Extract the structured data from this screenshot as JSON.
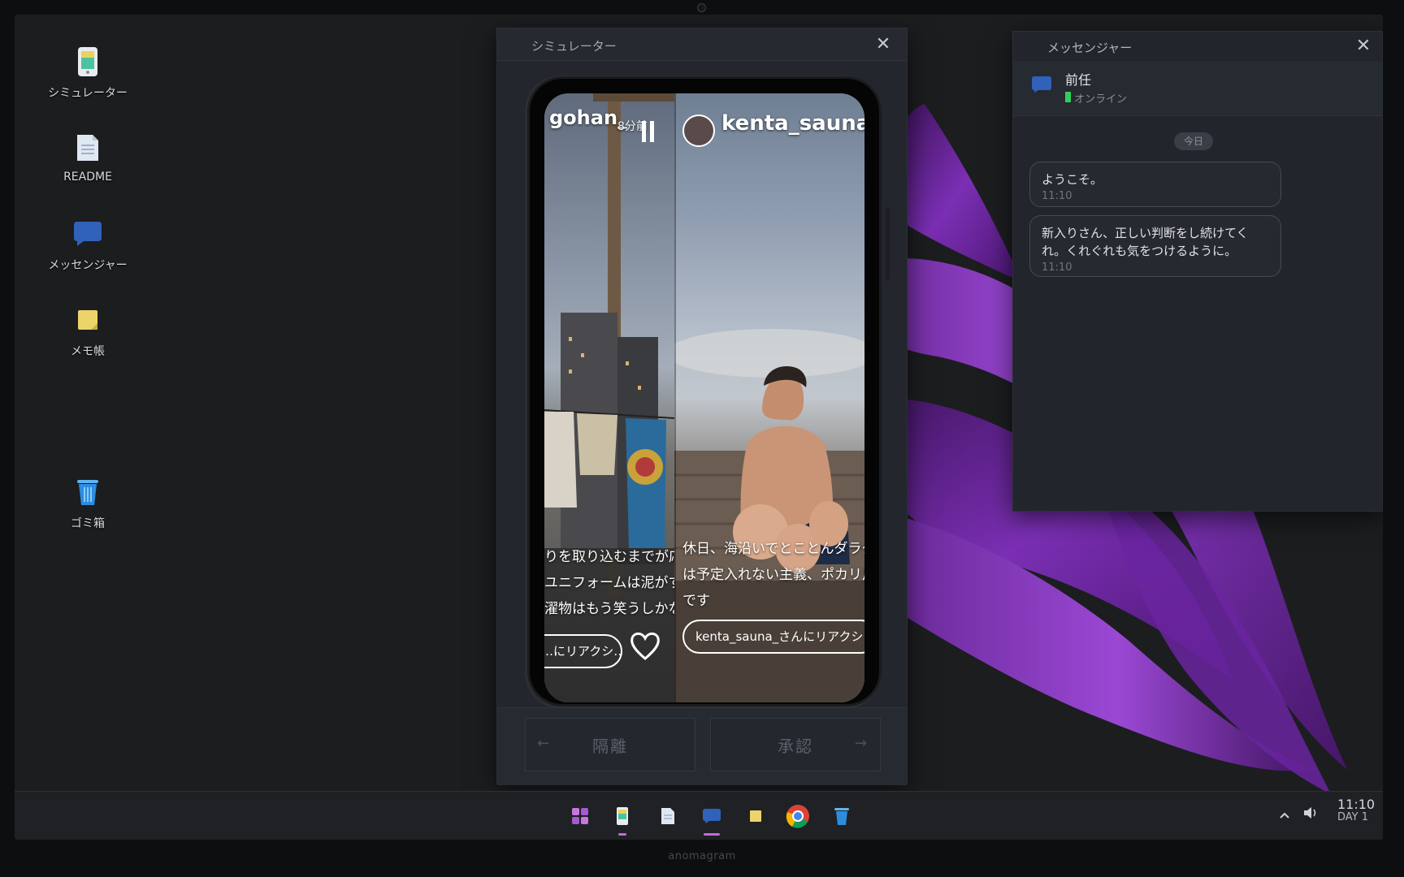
{
  "desktop": {
    "icons": [
      {
        "label": "シミュレーター",
        "icon": "simulator-icon"
      },
      {
        "label": "README",
        "icon": "document-icon"
      },
      {
        "label": "メッセンジャー",
        "icon": "chat-bubble-icon"
      },
      {
        "label": "メモ帳",
        "icon": "sticky-note-icon"
      },
      {
        "label": "ゴミ箱",
        "icon": "trash-icon"
      }
    ]
  },
  "simulator": {
    "title": "シミュレーター",
    "story_left": {
      "username": "gohan_",
      "time": "8分前",
      "caption_lines": [
        "りを取り込むまでが応援で",
        "ユニフォームは泥がすごくて",
        "濯物はもう笑うしかない"
      ],
      "reply_placeholder": "…にリアクシ…"
    },
    "story_right": {
      "username": "kenta_sauna_",
      "caption_lines": [
        "休日、海沿いでとことんダラダ",
        "は予定入れない主義、ポカリ片",
        "です"
      ],
      "reply_placeholder": "kenta_sauna_さんにリアクシ"
    },
    "actions": {
      "quarantine_label": "隔離",
      "approve_label": "承認",
      "left_arrow": "←",
      "right_arrow": "→"
    }
  },
  "messenger": {
    "title": "メッセンジャー",
    "contact": {
      "name": "前任",
      "status": "オンライン"
    },
    "day_label": "今日",
    "messages": [
      {
        "text": "ようこそ。",
        "time": "11:10"
      },
      {
        "text": "新入りさん、正しい判断をし続けてくれ。くれぐれも気をつけるように。",
        "time": "11:10"
      }
    ]
  },
  "taskbar": {
    "apps": [
      "start-icon",
      "simulator-icon",
      "document-icon",
      "chat-bubble-icon",
      "sticky-note-icon",
      "chrome-icon",
      "trash-icon"
    ],
    "clock_time": "11:10",
    "clock_day": "DAY 1"
  },
  "device": {
    "brand": "anomagram"
  },
  "colors": {
    "accent": "#c36bd9",
    "online": "#2fd05a",
    "wallpaper_petal": "#7a2fb0"
  }
}
